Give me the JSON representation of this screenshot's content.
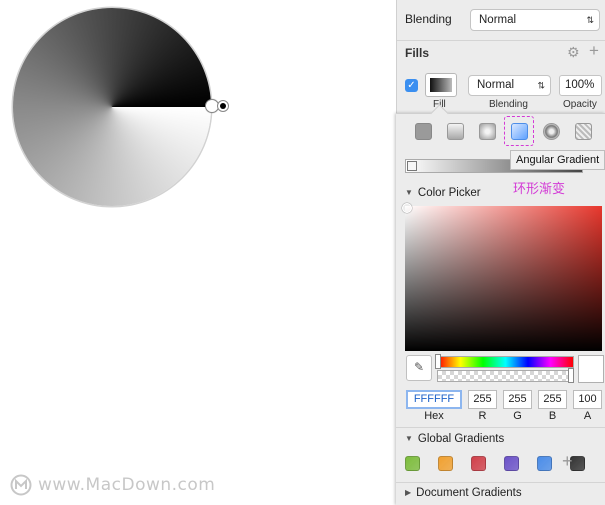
{
  "canvas": {
    "watermark": "www.MacDown.com"
  },
  "inspector": {
    "blending": {
      "label": "Blending",
      "value": "Normal"
    },
    "fills": {
      "title": "Fills",
      "fill_blending": "Normal",
      "opacity": "100%",
      "labels": {
        "fill": "Fill",
        "blending": "Blending",
        "opacity": "Opacity"
      }
    }
  },
  "popover": {
    "fill_types": [
      "Flat Color",
      "Linear Gradient",
      "Radial Gradient",
      "Angular Gradient",
      "Noise Fill",
      "Pattern Fill"
    ],
    "selected_fill_type": "Angular Gradient",
    "tooltip": "Angular Gradient",
    "annotation": "环形渐变",
    "color_picker": {
      "title": "Color Picker",
      "hex": "FFFFFF",
      "r": "255",
      "g": "255",
      "b": "255",
      "a": "100",
      "labels": {
        "hex": "Hex",
        "r": "R",
        "g": "G",
        "b": "B",
        "a": "A"
      }
    },
    "global_gradients": {
      "title": "Global Gradients",
      "swatches": [
        "#7cbc3c",
        "#f0a030",
        "#d0404a",
        "#6b52c8",
        "#4a8ce8",
        "#333333"
      ]
    },
    "document_gradients": {
      "title": "Document Gradients"
    }
  },
  "colors": {
    "accent": "#3b8ff0",
    "annotation": "#d33ad6"
  }
}
